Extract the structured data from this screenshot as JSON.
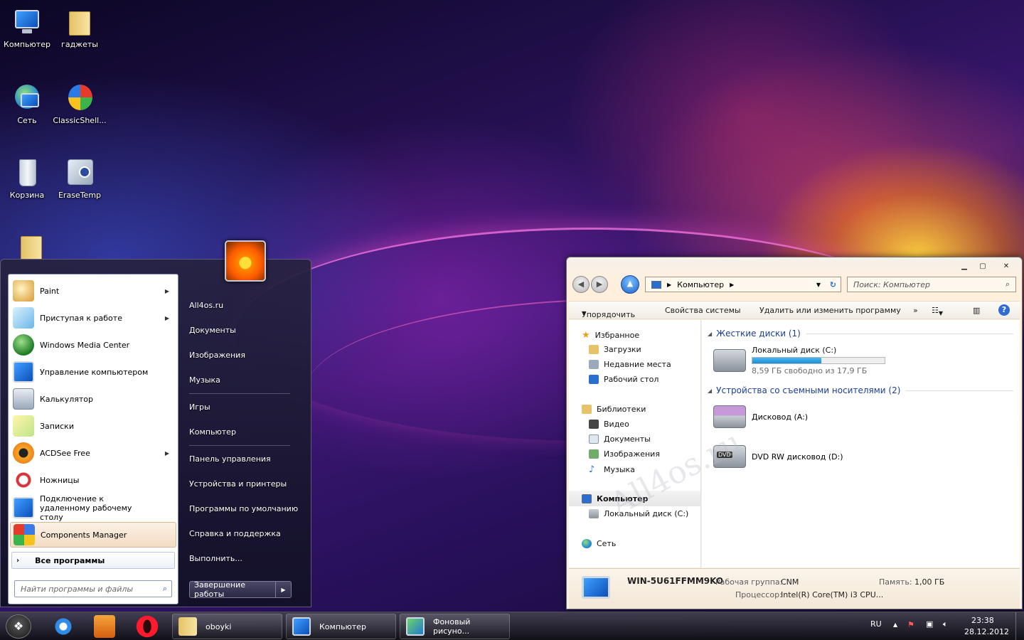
{
  "desktop": {
    "icons": [
      {
        "label": "Компьютер",
        "icon": "computer-icon"
      },
      {
        "label": "гаджеты",
        "icon": "folder-icon"
      },
      {
        "label": "Сеть",
        "icon": "network-icon"
      },
      {
        "label": "ClassicShell...",
        "icon": "classicshell-icon"
      },
      {
        "label": "Корзина",
        "icon": "recycle-bin-icon"
      },
      {
        "label": "EraseTemp",
        "icon": "erasetemp-icon"
      }
    ]
  },
  "start_menu": {
    "programs": [
      {
        "label": "Paint",
        "has_submenu": true,
        "icon": "paint-icon"
      },
      {
        "label": "Приступая к работе",
        "has_submenu": true,
        "icon": "getting-started-icon"
      },
      {
        "label": "Windows Media Center",
        "has_submenu": false,
        "icon": "media-center-icon"
      },
      {
        "label": "Управление компьютером",
        "has_submenu": false,
        "icon": "computer-management-icon"
      },
      {
        "label": "Калькулятор",
        "has_submenu": false,
        "icon": "calculator-icon"
      },
      {
        "label": "Записки",
        "has_submenu": false,
        "icon": "sticky-notes-icon"
      },
      {
        "label": "ACDSee Free",
        "has_submenu": true,
        "icon": "acdsee-icon"
      },
      {
        "label": "Ножницы",
        "has_submenu": false,
        "icon": "scissors-icon"
      },
      {
        "label": "Подключение к удаленному рабочему столу",
        "has_submenu": false,
        "icon": "remote-desktop-icon"
      },
      {
        "label": "Components Manager",
        "has_submenu": false,
        "icon": "components-manager-icon"
      }
    ],
    "all_programs": "Все программы",
    "search_placeholder": "Найти программы и файлы",
    "right_links": [
      "All4os.ru",
      "Документы",
      "Изображения",
      "Музыка",
      "Игры",
      "Компьютер",
      "Панель управления",
      "Устройства и принтеры",
      "Программы по умолчанию",
      "Справка и поддержка",
      "Выполнить..."
    ],
    "shutdown": "Завершение работы"
  },
  "explorer": {
    "address": "Компьютер",
    "search_placeholder": "Поиск: Компьютер",
    "toolbar": {
      "organize": "Упорядочить",
      "system_props": "Свойства системы",
      "uninstall": "Удалить или изменить программу",
      "more": "»"
    },
    "nav": {
      "favorites": "Избранное",
      "downloads": "Загрузки",
      "recent": "Недавние места",
      "desktop": "Рабочий стол",
      "libraries": "Библиотеки",
      "video": "Видео",
      "documents": "Документы",
      "images": "Изображения",
      "music": "Музыка",
      "computer": "Компьютер",
      "local_disk": "Локальный диск (C:)",
      "network": "Сеть"
    },
    "groups": {
      "hard_disks": "Жесткие диски (1)",
      "removable": "Устройства со съемными носителями (2)"
    },
    "drives": {
      "c": {
        "name": "Локальный диск (C:)",
        "free": "8,59 ГБ свободно из 17,9 ГБ",
        "used_fraction": 0.52
      },
      "a": {
        "name": "Дисковод (A:)"
      },
      "d": {
        "name": "DVD RW дисковод (D:)",
        "badge": "DVD"
      }
    },
    "details": {
      "pc_name": "WIN-5U61FFMM9KO",
      "workgroup_label": "Рабочая группа:",
      "workgroup": "CNM",
      "memory_label": "Память:",
      "memory": "1,00 ГБ",
      "cpu_label": "Процессор:",
      "cpu": "Intel(R) Core(TM) i3 CPU..."
    }
  },
  "watermark": "All4os.ru",
  "taskbar": {
    "buttons": [
      {
        "label": "oboyki",
        "icon": "folder-icon"
      },
      {
        "label": "Компьютер",
        "icon": "computer-icon"
      },
      {
        "label": "Фоновый рисуно...",
        "icon": "wallpaper-icon"
      }
    ],
    "lang": "RU",
    "time": "23:38",
    "date": "28.12.2012"
  },
  "colors": {
    "accent": "#1c3e98",
    "progress": "#1e8fd6"
  }
}
